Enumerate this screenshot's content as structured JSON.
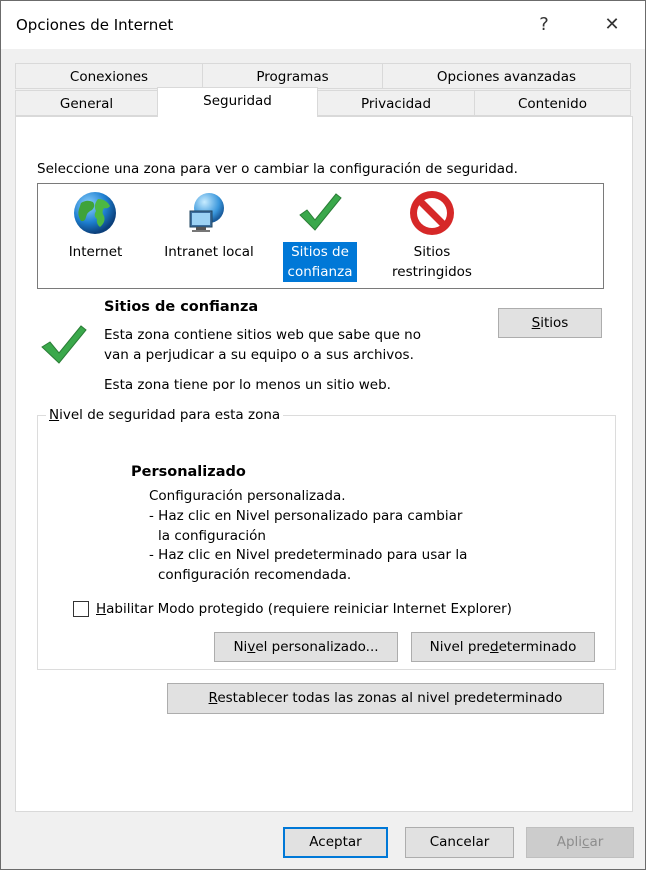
{
  "window": {
    "title": "Opciones de Internet",
    "help_glyph": "?",
    "close_glyph": "✕"
  },
  "tabs": {
    "row1": [
      "Conexiones",
      "Programas",
      "Opciones avanzadas"
    ],
    "row2": [
      "General",
      "Seguridad",
      "Privacidad",
      "Contenido"
    ],
    "active": "Seguridad"
  },
  "zones": {
    "instruction": "Seleccione una zona para ver o cambiar la configuración de seguridad.",
    "items": [
      {
        "line1": "Internet",
        "line2": "",
        "icon": "globe-icon"
      },
      {
        "line1": "Intranet local",
        "line2": "",
        "icon": "intranet-icon"
      },
      {
        "line1": "Sitios de",
        "line2": "confianza",
        "icon": "checkmark-icon",
        "selected": true
      },
      {
        "line1": "Sitios",
        "line2": "restringidos",
        "icon": "restricted-icon"
      }
    ]
  },
  "zone_info": {
    "title": "Sitios de confianza",
    "desc_line1": "Esta zona contiene sitios web que sabe que no",
    "desc_line2": "van a perjudicar a su equipo o a sus archivos.",
    "note": "Esta zona tiene por lo menos un sitio web.",
    "sites_button_prefix": "",
    "sites_button_underlined": "S",
    "sites_button_rest": "itios"
  },
  "security_level": {
    "group_prefix": "",
    "group_underlined": "N",
    "group_rest": "ivel de seguridad para esta zona",
    "heading": "Personalizado",
    "line1": "Configuración personalizada.",
    "line2": "- Haz clic en Nivel personalizado para cambiar",
    "line3": "la configuración",
    "line4": "- Haz clic en Nivel predeterminado para usar la",
    "line5": "configuración recomendada.",
    "protected_mode_underlined": "H",
    "protected_mode_rest": "abilitar Modo protegido (requiere reiniciar Internet Explorer)",
    "protected_mode_checked": false,
    "custom_btn_prefix": "Ni",
    "custom_btn_underlined": "v",
    "custom_btn_rest": "el personalizado...",
    "default_btn_prefix": "Nivel pre",
    "default_btn_underlined": "d",
    "default_btn_rest": "eterminado"
  },
  "reset_button": {
    "underlined": "R",
    "rest": "establecer todas las zonas al nivel predeterminado"
  },
  "footer": {
    "ok": "Aceptar",
    "cancel": "Cancelar",
    "apply_prefix": "Apli",
    "apply_underlined": "c",
    "apply_rest": "ar"
  },
  "colors": {
    "accent": "#0078d7",
    "check_green": "#3aa84b",
    "restricted_red": "#d62828"
  }
}
